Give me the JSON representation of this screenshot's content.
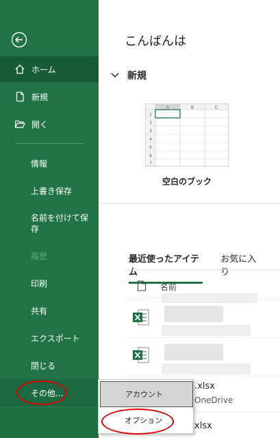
{
  "sidebar": {
    "home": "ホーム",
    "new": "新規",
    "open": "開く",
    "info": "情報",
    "save": "上書き保存",
    "save_as": "名前を付けて保存",
    "history": "履歴",
    "print": "印刷",
    "share": "共有",
    "export": "エクスポート",
    "close": "閉じる",
    "more": "その他..."
  },
  "main": {
    "greeting": "こんばんは",
    "new_section": "新規",
    "template_label": "空白のブック",
    "template_columns": [
      "A",
      "B",
      "C"
    ],
    "template_rows": [
      "1",
      "2",
      "3",
      "4",
      "5",
      "6",
      "7"
    ],
    "tabs": [
      "最近使ったアイテム",
      "お気に入り"
    ],
    "list_header_name": "名前",
    "files": [
      {
        "name_suffix": ".xlsx",
        "location_suffix": "OneDrive"
      },
      {
        "name_suffix": "xlsx",
        "location_suffix": ""
      }
    ]
  },
  "popup": {
    "account": "アカウント",
    "options": "オプション"
  },
  "colors": {
    "sidebar": "#217346",
    "selected": "#185c37",
    "annotation": "#e00000"
  }
}
